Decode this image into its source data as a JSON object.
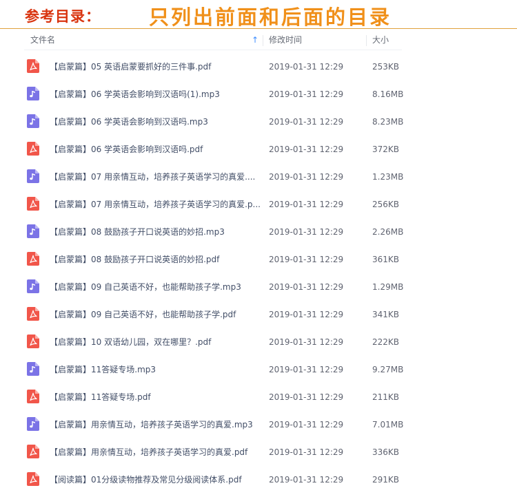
{
  "banner": {
    "label": "参考目录：",
    "note": "只列出前面和后面的目录"
  },
  "header": {
    "name": "文件名",
    "sort_icon": "↑",
    "modified": "修改时间",
    "size": "大小"
  },
  "colors": {
    "pdf": "#f1564a",
    "mp3": "#7b73e6",
    "banner_red": "#d9340f",
    "banner_orange": "#f0901a"
  },
  "files": [
    {
      "type": "pdf",
      "icon": "pdf-icon",
      "name": "【启蒙篇】05 英语启蒙要抓好的三件事.pdf",
      "time": "2019-01-31 12:29",
      "size": "253KB"
    },
    {
      "type": "mp3",
      "icon": "music-file-icon",
      "name": "【启蒙篇】06 学英语会影响到汉语吗(1).mp3",
      "time": "2019-01-31 12:29",
      "size": "8.16MB"
    },
    {
      "type": "mp3",
      "icon": "music-file-icon",
      "name": "【启蒙篇】06 学英语会影响到汉语吗.mp3",
      "time": "2019-01-31 12:29",
      "size": "8.23MB"
    },
    {
      "type": "pdf",
      "icon": "pdf-icon",
      "name": "【启蒙篇】06 学英语会影响到汉语吗.pdf",
      "time": "2019-01-31 12:29",
      "size": "372KB"
    },
    {
      "type": "mp3",
      "icon": "music-file-icon",
      "name": "【启蒙篇】07 用亲情互动，培养孩子英语学习的真爱....",
      "time": "2019-01-31 12:29",
      "size": "1.23MB"
    },
    {
      "type": "pdf",
      "icon": "pdf-icon",
      "name": "【启蒙篇】07 用亲情互动，培养孩子英语学习的真爱.p...",
      "time": "2019-01-31 12:29",
      "size": "256KB"
    },
    {
      "type": "mp3",
      "icon": "music-file-icon",
      "name": "【启蒙篇】08 鼓励孩子开口说英语的妙招.mp3",
      "time": "2019-01-31 12:29",
      "size": "2.26MB"
    },
    {
      "type": "pdf",
      "icon": "pdf-icon",
      "name": "【启蒙篇】08 鼓励孩子开口说英语的妙招.pdf",
      "time": "2019-01-31 12:29",
      "size": "361KB"
    },
    {
      "type": "mp3",
      "icon": "music-file-icon",
      "name": "【启蒙篇】09 自己英语不好，也能帮助孩子学.mp3",
      "time": "2019-01-31 12:29",
      "size": "1.29MB"
    },
    {
      "type": "pdf",
      "icon": "pdf-icon",
      "name": "【启蒙篇】09 自己英语不好，也能帮助孩子学.pdf",
      "time": "2019-01-31 12:29",
      "size": "341KB"
    },
    {
      "type": "pdf",
      "icon": "pdf-icon",
      "name": "【启蒙篇】10 双语幼儿园，双在哪里？.pdf",
      "time": "2019-01-31 12:29",
      "size": "222KB"
    },
    {
      "type": "mp3",
      "icon": "music-file-icon",
      "name": "【启蒙篇】11答疑专场.mp3",
      "time": "2019-01-31 12:29",
      "size": "9.27MB"
    },
    {
      "type": "pdf",
      "icon": "pdf-icon",
      "name": "【启蒙篇】11答疑专场.pdf",
      "time": "2019-01-31 12:29",
      "size": "211KB"
    },
    {
      "type": "mp3",
      "icon": "music-file-icon",
      "name": "【启蒙篇】用亲情互动，培养孩子英语学习的真爱.mp3",
      "time": "2019-01-31 12:29",
      "size": "7.01MB"
    },
    {
      "type": "pdf",
      "icon": "pdf-icon",
      "name": "【启蒙篇】用亲情互动，培养孩子英语学习的真爱.pdf",
      "time": "2019-01-31 12:29",
      "size": "336KB"
    },
    {
      "type": "pdf",
      "icon": "pdf-icon",
      "name": "【阅读篇】01分级读物推荐及常见分级阅读体系.pdf",
      "time": "2019-01-31 12:29",
      "size": "291KB"
    }
  ]
}
